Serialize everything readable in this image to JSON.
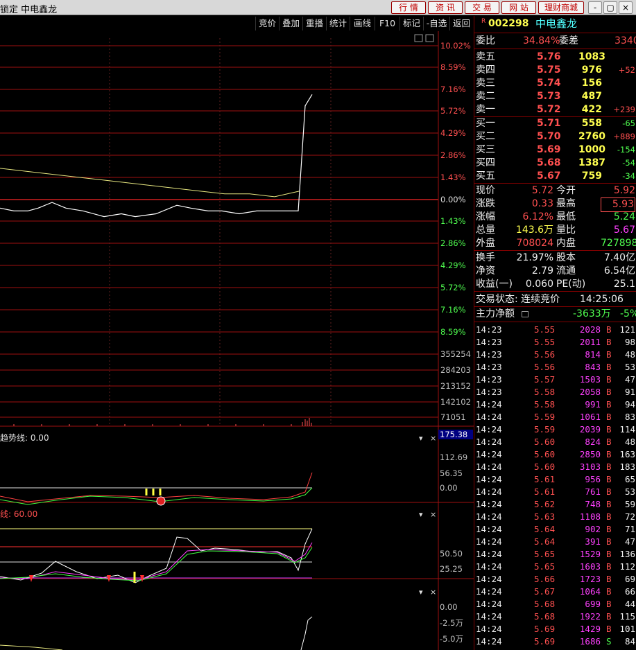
{
  "window": {
    "title": "锁定  中电鑫龙",
    "buttons": [
      "行  情",
      "资  讯",
      "交  易",
      "网  站",
      "理财商城"
    ],
    "controls": [
      "-",
      "▢",
      "×"
    ]
  },
  "toolbar": [
    "竞价",
    "叠加",
    "重播",
    "统计",
    "画线",
    "F10",
    "标记",
    "-自选",
    "返回"
  ],
  "price_axis": {
    "right_labels": [
      "10.02%",
      "8.59%",
      "7.16%",
      "5.72%",
      "4.29%",
      "2.86%",
      "1.43%",
      "0.00%",
      "1.43%",
      "2.86%",
      "4.29%",
      "5.72%",
      "7.16%",
      "8.59%"
    ],
    "volume_labels": [
      "355254",
      "284203",
      "213152",
      "142102",
      "71051"
    ]
  },
  "chart_data": {
    "type": "line",
    "series": [
      {
        "name": "价格",
        "values": [
          5.36,
          5.35,
          5.35,
          5.36,
          5.38,
          5.36,
          5.35,
          5.33,
          5.34,
          5.33,
          5.34,
          5.37,
          5.36,
          5.35,
          5.35,
          5.34,
          5.35,
          5.35,
          5.35,
          5.35,
          5.72,
          5.76
        ]
      },
      {
        "name": "均价",
        "values": [
          5.5,
          5.49,
          5.48,
          5.47,
          5.46,
          5.45,
          5.44,
          5.43,
          5.42,
          5.41,
          5.41,
          5.4,
          5.42
        ]
      }
    ],
    "indicator_labels": {
      "trend": "趋势线: 0.00",
      "trend_axis": [
        "175.38",
        "112.69",
        "56.35",
        "0.00"
      ],
      "kdj": "60.00",
      "kdj_axis": [
        "50.50",
        "25.25"
      ],
      "bottom_axis": [
        "0.00",
        "-2.5万",
        "-5.0万"
      ]
    }
  },
  "quote": {
    "code_prefix": "R",
    "code": "002298",
    "name": "中电鑫龙",
    "weibi_label": "委比",
    "weibi": "34.84%",
    "weicha_label": "委差",
    "weicha": "3340",
    "asks": [
      {
        "label": "卖五",
        "price": "5.76",
        "vol": "1083",
        "chg": ""
      },
      {
        "label": "卖四",
        "price": "5.75",
        "vol": "976",
        "chg": "+52"
      },
      {
        "label": "卖三",
        "price": "5.74",
        "vol": "156",
        "chg": ""
      },
      {
        "label": "卖二",
        "price": "5.73",
        "vol": "487",
        "chg": ""
      },
      {
        "label": "卖一",
        "price": "5.72",
        "vol": "422",
        "chg": "+239"
      }
    ],
    "bids": [
      {
        "label": "买一",
        "price": "5.71",
        "vol": "558",
        "chg": "-65"
      },
      {
        "label": "买二",
        "price": "5.70",
        "vol": "2760",
        "chg": "+889"
      },
      {
        "label": "买三",
        "price": "5.69",
        "vol": "1000",
        "chg": "-154"
      },
      {
        "label": "买四",
        "price": "5.68",
        "vol": "1387",
        "chg": "-54"
      },
      {
        "label": "买五",
        "price": "5.67",
        "vol": "759",
        "chg": "-34"
      }
    ],
    "stats": [
      {
        "l1": "现价",
        "v1": "5.72",
        "l2": "今开",
        "v2": "5.92",
        "c1": "red",
        "c2": "red"
      },
      {
        "l1": "涨跌",
        "v1": "0.33",
        "l2": "最高",
        "v2": "5.93",
        "c1": "red",
        "c2": "red"
      },
      {
        "l1": "涨幅",
        "v1": "6.12%",
        "l2": "最低",
        "v2": "5.24",
        "c1": "red",
        "c2": "grn"
      },
      {
        "l1": "总量",
        "v1": "143.6万",
        "l2": "量比",
        "v2": "5.67",
        "c1": "yel",
        "c2": "mag"
      },
      {
        "l1": "外盘",
        "v1": "708024",
        "l2": "内盘",
        "v2": "727898",
        "c1": "red",
        "c2": "grn"
      }
    ],
    "stats2": [
      {
        "l1": "换手",
        "v1": "21.97%",
        "l2": "股本",
        "v2": "7.40亿"
      },
      {
        "l1": "净资",
        "v1": "2.79",
        "l2": "流通",
        "v2": "6.54亿"
      },
      {
        "l1": "收益(一)",
        "v1": "0.060",
        "l2": "PE(动)",
        "v2": "25.1"
      }
    ],
    "status_label": "交易状态: 连续竞价",
    "status_time": "14:25:06",
    "main_flow_label": "主力净额",
    "main_flow_val": "-3633万",
    "main_flow_pct": "-5%"
  },
  "ticks": [
    {
      "t": "14:23",
      "p": "5.55",
      "v": "2028",
      "s": "B",
      "n": "121"
    },
    {
      "t": "14:23",
      "p": "5.55",
      "v": "2011",
      "s": "B",
      "n": "98"
    },
    {
      "t": "14:23",
      "p": "5.56",
      "v": "814",
      "s": "B",
      "n": "48"
    },
    {
      "t": "14:23",
      "p": "5.56",
      "v": "843",
      "s": "B",
      "n": "53"
    },
    {
      "t": "14:23",
      "p": "5.57",
      "v": "1503",
      "s": "B",
      "n": "47"
    },
    {
      "t": "14:23",
      "p": "5.58",
      "v": "2058",
      "s": "B",
      "n": "91"
    },
    {
      "t": "14:24",
      "p": "5.58",
      "v": "991",
      "s": "B",
      "n": "94"
    },
    {
      "t": "14:24",
      "p": "5.59",
      "v": "1061",
      "s": "B",
      "n": "83"
    },
    {
      "t": "14:24",
      "p": "5.59",
      "v": "2039",
      "s": "B",
      "n": "114"
    },
    {
      "t": "14:24",
      "p": "5.60",
      "v": "824",
      "s": "B",
      "n": "48"
    },
    {
      "t": "14:24",
      "p": "5.60",
      "v": "2850",
      "s": "B",
      "n": "163"
    },
    {
      "t": "14:24",
      "p": "5.60",
      "v": "3103",
      "s": "B",
      "n": "183"
    },
    {
      "t": "14:24",
      "p": "5.61",
      "v": "956",
      "s": "B",
      "n": "65"
    },
    {
      "t": "14:24",
      "p": "5.61",
      "v": "761",
      "s": "B",
      "n": "53"
    },
    {
      "t": "14:24",
      "p": "5.62",
      "v": "748",
      "s": "B",
      "n": "59"
    },
    {
      "t": "14:24",
      "p": "5.63",
      "v": "1108",
      "s": "B",
      "n": "72"
    },
    {
      "t": "14:24",
      "p": "5.64",
      "v": "902",
      "s": "B",
      "n": "71"
    },
    {
      "t": "14:24",
      "p": "5.64",
      "v": "391",
      "s": "B",
      "n": "47"
    },
    {
      "t": "14:24",
      "p": "5.65",
      "v": "1529",
      "s": "B",
      "n": "136"
    },
    {
      "t": "14:24",
      "p": "5.65",
      "v": "1603",
      "s": "B",
      "n": "112"
    },
    {
      "t": "14:24",
      "p": "5.66",
      "v": "1723",
      "s": "B",
      "n": "69"
    },
    {
      "t": "14:24",
      "p": "5.67",
      "v": "1064",
      "s": "B",
      "n": "66"
    },
    {
      "t": "14:24",
      "p": "5.68",
      "v": "699",
      "s": "B",
      "n": "44"
    },
    {
      "t": "14:24",
      "p": "5.68",
      "v": "1922",
      "s": "B",
      "n": "115"
    },
    {
      "t": "14:24",
      "p": "5.69",
      "v": "1429",
      "s": "B",
      "n": "101"
    },
    {
      "t": "14:24",
      "p": "5.69",
      "v": "1686",
      "s": "S",
      "n": "84"
    }
  ]
}
